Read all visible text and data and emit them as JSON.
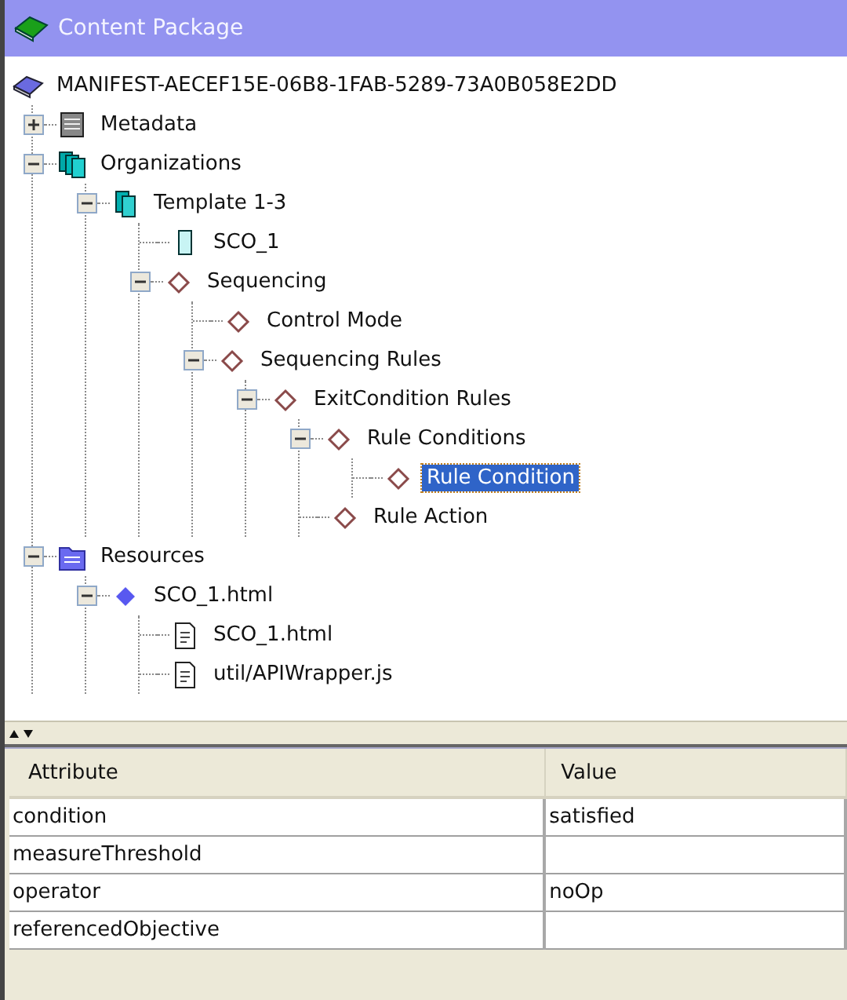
{
  "panel": {
    "title": "Content Package"
  },
  "tree": {
    "label": "MANIFEST-AECEF15E-06B8-1FAB-5289-73A0B058E2DD",
    "kind": "book",
    "selected": false,
    "children": [
      {
        "label": "Metadata",
        "kind": "metadata",
        "expanded": false,
        "selected": false
      },
      {
        "label": "Organizations",
        "kind": "organizations",
        "expanded": true,
        "selected": false,
        "children": [
          {
            "label": "Template 1-3",
            "kind": "organization",
            "expanded": true,
            "selected": false,
            "children": [
              {
                "label": "SCO_1",
                "kind": "item",
                "selected": false
              },
              {
                "label": "Sequencing",
                "kind": "diamond",
                "expanded": true,
                "selected": false,
                "children": [
                  {
                    "label": "Control Mode",
                    "kind": "diamond",
                    "selected": false
                  },
                  {
                    "label": "Sequencing Rules",
                    "kind": "diamond",
                    "expanded": true,
                    "selected": false,
                    "children": [
                      {
                        "label": "ExitCondition Rules",
                        "kind": "diamond",
                        "expanded": true,
                        "selected": false,
                        "children": [
                          {
                            "label": "Rule Conditions",
                            "kind": "diamond",
                            "expanded": true,
                            "selected": false,
                            "children": [
                              {
                                "label": "Rule Condition",
                                "kind": "diamond",
                                "selected": true
                              }
                            ]
                          },
                          {
                            "label": "Rule Action",
                            "kind": "diamond",
                            "selected": false
                          }
                        ]
                      }
                    ]
                  }
                ]
              }
            ]
          }
        ]
      },
      {
        "label": "Resources",
        "kind": "folder",
        "expanded": true,
        "selected": false,
        "children": [
          {
            "label": "SCO_1.html",
            "kind": "resource",
            "expanded": true,
            "selected": false,
            "children": [
              {
                "label": "SCO_1.html",
                "kind": "file",
                "selected": false
              },
              {
                "label": "util/APIWrapper.js",
                "kind": "file",
                "selected": false
              }
            ]
          }
        ]
      }
    ]
  },
  "table": {
    "columns": [
      "Attribute",
      "Value"
    ],
    "rows": [
      {
        "attribute": "condition",
        "value": "satisfied"
      },
      {
        "attribute": "measureThreshold"
      },
      {
        "attribute": "operator",
        "value": "noOp"
      },
      {
        "attribute": "referencedObjective"
      }
    ]
  }
}
